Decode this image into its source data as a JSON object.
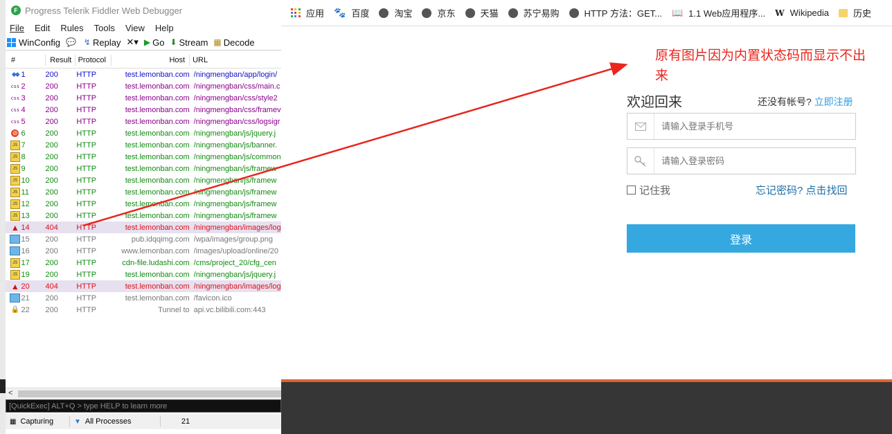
{
  "fiddler": {
    "title": "Progress Telerik Fiddler Web Debugger",
    "menu": [
      "File",
      "Edit",
      "Rules",
      "Tools",
      "View",
      "Help"
    ],
    "toolbar": {
      "winconfig": "WinConfig",
      "replay": "Replay",
      "remove": "✕▾",
      "go": "Go",
      "stream": "Stream",
      "decode": "Decode"
    },
    "columns": {
      "num": "#",
      "result": "Result",
      "protocol": "Protocol",
      "host": "Host",
      "url": "URL"
    },
    "sessions": [
      {
        "num": "1",
        "result": "200",
        "protocol": "HTTP",
        "host": "test.lemonban.com",
        "url": "/ningmengban/app/login/",
        "color": "blue",
        "icon": "arrows-icon"
      },
      {
        "num": "2",
        "result": "200",
        "protocol": "HTTP",
        "host": "test.lemonban.com",
        "url": "/ningmengban/css/main.c",
        "color": "purple",
        "icon": "css-icon"
      },
      {
        "num": "3",
        "result": "200",
        "protocol": "HTTP",
        "host": "test.lemonban.com",
        "url": "/ningmengban/css/style2",
        "color": "purple",
        "icon": "css-icon"
      },
      {
        "num": "4",
        "result": "200",
        "protocol": "HTTP",
        "host": "test.lemonban.com",
        "url": "/ningmengban/css/framev",
        "color": "purple",
        "icon": "css-icon"
      },
      {
        "num": "5",
        "result": "200",
        "protocol": "HTTP",
        "host": "test.lemonban.com",
        "url": "/ningmengban/css/logsigr",
        "color": "purple",
        "icon": "css-icon"
      },
      {
        "num": "6",
        "result": "200",
        "protocol": "HTTP",
        "host": "test.lemonban.com",
        "url": "/ningmengban/js/jquery.j",
        "color": "green",
        "icon": "blocked-icon"
      },
      {
        "num": "7",
        "result": "200",
        "protocol": "HTTP",
        "host": "test.lemonban.com",
        "url": "/ningmengban/js/banner.",
        "color": "green",
        "icon": "js-icon"
      },
      {
        "num": "8",
        "result": "200",
        "protocol": "HTTP",
        "host": "test.lemonban.com",
        "url": "/ningmengban/js/common",
        "color": "green",
        "icon": "js-icon"
      },
      {
        "num": "9",
        "result": "200",
        "protocol": "HTTP",
        "host": "test.lemonban.com",
        "url": "/ningmengban/js/framew",
        "color": "green",
        "icon": "js-icon"
      },
      {
        "num": "10",
        "result": "200",
        "protocol": "HTTP",
        "host": "test.lemonban.com",
        "url": "/ningmengban/js/framew",
        "color": "green",
        "icon": "js-icon"
      },
      {
        "num": "11",
        "result": "200",
        "protocol": "HTTP",
        "host": "test.lemonban.com",
        "url": "/ningmengban/js/framew",
        "color": "green",
        "icon": "js-icon"
      },
      {
        "num": "12",
        "result": "200",
        "protocol": "HTTP",
        "host": "test.lemonban.com",
        "url": "/ningmengban/js/framew",
        "color": "green",
        "icon": "js-icon"
      },
      {
        "num": "13",
        "result": "200",
        "protocol": "HTTP",
        "host": "test.lemonban.com",
        "url": "/ningmengban/js/framew",
        "color": "green",
        "icon": "js-icon"
      },
      {
        "num": "14",
        "result": "404",
        "protocol": "HTTP",
        "host": "test.lemonban.com",
        "url": "/ningmengban/images/log",
        "color": "red",
        "icon": "warning-icon",
        "selected": true
      },
      {
        "num": "15",
        "result": "200",
        "protocol": "HTTP",
        "host": "pub.idqqimg.com",
        "url": "/wpa/images/group.png",
        "color": "gray",
        "icon": "image-icon"
      },
      {
        "num": "16",
        "result": "200",
        "protocol": "HTTP",
        "host": "www.lemonban.com",
        "url": "/images/upload/online/20",
        "color": "gray",
        "icon": "image-icon"
      },
      {
        "num": "17",
        "result": "200",
        "protocol": "HTTP",
        "host": "cdn-file.ludashi.com",
        "url": "/cms/project_20/cfg_cen",
        "color": "green",
        "icon": "js-icon"
      },
      {
        "num": "19",
        "result": "200",
        "protocol": "HTTP",
        "host": "test.lemonban.com",
        "url": "/ningmengban/js/jquery.j",
        "color": "green",
        "icon": "js-icon"
      },
      {
        "num": "20",
        "result": "404",
        "protocol": "HTTP",
        "host": "test.lemonban.com",
        "url": "/ningmengban/images/log",
        "color": "red",
        "icon": "warning-icon",
        "selected": true
      },
      {
        "num": "21",
        "result": "200",
        "protocol": "HTTP",
        "host": "test.lemonban.com",
        "url": "/favicon.ico",
        "color": "gray",
        "icon": "image-icon"
      },
      {
        "num": "22",
        "result": "200",
        "protocol": "HTTP",
        "host": "Tunnel to",
        "url": "api.vc.bilibili.com:443",
        "color": "gray",
        "icon": "lock-icon"
      }
    ],
    "quickexec_placeholder": "[QuickExec] ALT+Q > type HELP to learn more",
    "status": {
      "capturing": "Capturing",
      "processes": "All Processes",
      "count": "21"
    }
  },
  "colors": {
    "blue": "#1010c8",
    "purple": "#8a008a",
    "green": "#128a12",
    "red": "#e0101a",
    "gray": "#777777",
    "accent": "#35a8e0",
    "annotation": "#e8261e",
    "footer_line": "#e3632d"
  },
  "browser": {
    "bookmarks": [
      {
        "label": "应用",
        "icon": "apps-icon"
      },
      {
        "label": "百度",
        "icon": "baidu-icon"
      },
      {
        "label": "淘宝",
        "icon": "globe-icon"
      },
      {
        "label": "京东",
        "icon": "globe-icon"
      },
      {
        "label": "天猫",
        "icon": "globe-icon"
      },
      {
        "label": "苏宁易购",
        "icon": "globe-icon"
      },
      {
        "label": "HTTP 方法：GET...",
        "icon": "globe-icon"
      },
      {
        "label": "1.1 Web应用程序...",
        "icon": "book-icon"
      },
      {
        "label": "Wikipedia",
        "icon": "wikipedia-icon"
      },
      {
        "label": "历史",
        "icon": "folder-icon"
      }
    ],
    "annotation": "原有图片因为内置状态码而显示不出来",
    "login": {
      "title": "欢迎回来",
      "no_account": "还没有帐号?",
      "signup_link": "立即注册",
      "phone_placeholder": "请输入登录手机号",
      "password_placeholder": "请输入登录密码",
      "remember": "记住我",
      "forgot": "忘记密码? 点击找回",
      "submit": "登录"
    }
  }
}
